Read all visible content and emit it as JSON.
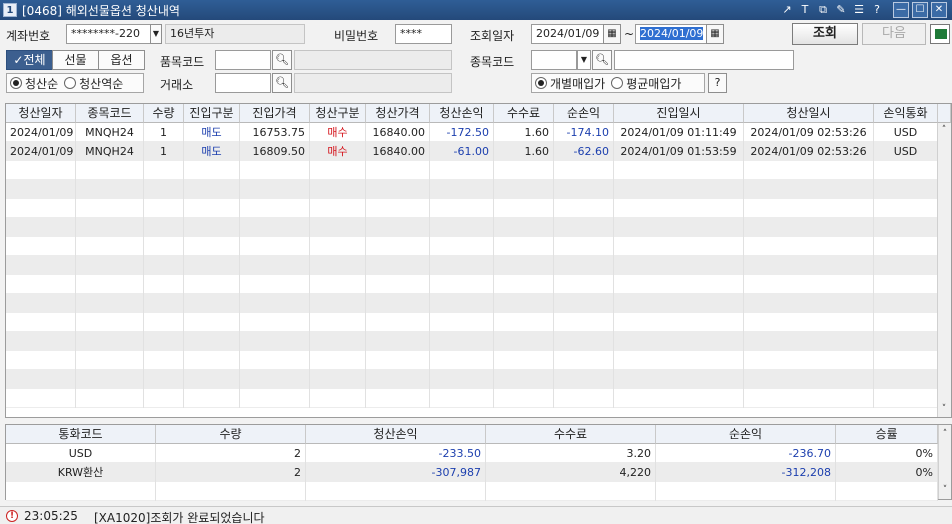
{
  "window": {
    "app_icon": "1",
    "title": "[0468] 해외선물옵션 청산내역",
    "controls": [
      "↗",
      "T",
      "⧉",
      "✎",
      "☰",
      "?",
      "—",
      "☐",
      "✕"
    ]
  },
  "filters": {
    "account_label": "계좌번호",
    "account_value": "********-220",
    "account_name": "16년투자",
    "password_label": "비밀번호",
    "password_value": "****",
    "date_label": "조회일자",
    "date_from": "2024/01/09",
    "date_sep": "~",
    "date_to": "2024/01/09",
    "query_button": "조회",
    "next_button": "다음",
    "tabs": [
      "전체",
      "선물",
      "옵션"
    ],
    "active_tab": "전체",
    "product_code_label": "품목코드",
    "item_code_label": "종목코드",
    "sort_options": [
      "청산순",
      "청산역순"
    ],
    "sort_selected": "청산순",
    "exchange_label": "거래소",
    "buy_mode_options": [
      "개별매입가",
      "평균매입가"
    ],
    "buy_mode_selected": "개별매입가",
    "help_button": "?"
  },
  "main_table": {
    "columns": [
      "청산일자",
      "종목코드",
      "수량",
      "진입구분",
      "진입가격",
      "청산구분",
      "청산가격",
      "청산손익",
      "수수료",
      "순손익",
      "진입일시",
      "청산일시",
      "손익통화"
    ],
    "rows": [
      [
        "2024/01/09",
        "MNQH24",
        "1",
        "매도",
        "16753.75",
        "매수",
        "16840.00",
        "-172.50",
        "1.60",
        "-174.10",
        "2024/01/09 01:11:49",
        "2024/01/09 02:53:26",
        "USD"
      ],
      [
        "2024/01/09",
        "MNQH24",
        "1",
        "매도",
        "16809.50",
        "매수",
        "16840.00",
        "-61.00",
        "1.60",
        "-62.60",
        "2024/01/09 01:53:59",
        "2024/01/09 02:53:26",
        "USD"
      ]
    ]
  },
  "summary_table": {
    "columns": [
      "통화코드",
      "수량",
      "청산손익",
      "수수료",
      "순손익",
      "승률"
    ],
    "rows": [
      [
        "USD",
        "2",
        "-233.50",
        "3.20",
        "-236.70",
        "0%"
      ],
      [
        "KRW환산",
        "2",
        "-307,987",
        "4,220",
        "-312,208",
        "0%"
      ]
    ]
  },
  "status": {
    "icon": "!",
    "time": "23:05:25",
    "message": "[XA1020]조회가 완료되었습니다"
  },
  "colors": {
    "titlebar": "#2f5e96",
    "negative": "#1c3fae",
    "buy": "#d4141c",
    "sell": "#1c3fae",
    "header_bg": "#eef2f8",
    "row_alt": "#ececec"
  }
}
